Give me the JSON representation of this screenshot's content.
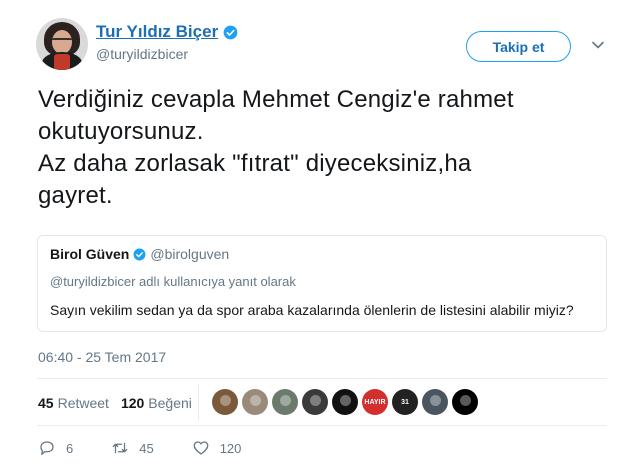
{
  "author": {
    "display_name": "Tur Yıldız Biçer",
    "handle": "@turyildizbicer",
    "verified": true
  },
  "follow_button": {
    "label": "Takip et"
  },
  "tweet": {
    "lines": [
      "Verdiğiniz cevapla Mehmet Cengiz'e rahmet",
      "okutuyorsunuz.",
      "Az daha zorlasak \"fıtrat\" diyeceksiniz,ha",
      "gayret."
    ],
    "timestamp": "06:40 - 25 Tem 2017"
  },
  "quoted_tweet": {
    "name": "Birol Güven",
    "handle": "@birolguven",
    "verified": true,
    "reply_context": "@turyildizbicer adlı kullanıcıya yanıt olarak",
    "text": "Sayın vekilim sedan ya da spor araba kazalarında ölenlerin de listesini alabilir miyiz?"
  },
  "stats": {
    "retweets_count": "45",
    "retweets_label": "Retweet",
    "likes_count": "120",
    "likes_label": "Beğeni"
  },
  "likers": [
    {
      "icon": "avatar-man-hat",
      "color": "#7a5a3a"
    },
    {
      "icon": "avatar-man",
      "color": "#9a8a7a"
    },
    {
      "icon": "avatar-group",
      "color": "#6b7a6a"
    },
    {
      "icon": "avatar-woman",
      "color": "#3a3a3a"
    },
    {
      "icon": "avatar-logo-triangle",
      "color": "#111111"
    },
    {
      "icon": "avatar-hayir-logo",
      "color": "#d32f2f",
      "text": "HAYIR"
    },
    {
      "icon": "avatar-31-logo",
      "color": "#222222",
      "text": "31"
    },
    {
      "icon": "avatar-person-dark",
      "color": "#4a5560"
    },
    {
      "icon": "avatar-black",
      "color": "#000000"
    }
  ],
  "actions": {
    "reply_count": "6",
    "retweet_count": "45",
    "like_count": "120"
  },
  "colors": {
    "link_blue": "#1b6fb5",
    "twitter_blue": "#1da1f2",
    "gray_text": "#657786",
    "border": "#e1e8ed"
  }
}
